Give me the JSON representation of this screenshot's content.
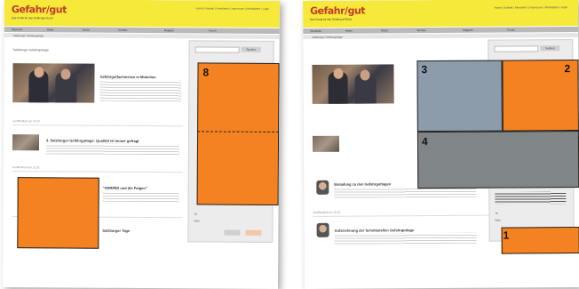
{
  "brand": {
    "logo": "Gefahr/gut",
    "tagline": "Das Portal für das Gefahrgut-Recht"
  },
  "header": {
    "top_links": "Home | Kontakt | Newsletter | Impressum | Mediadaten | Login"
  },
  "left": {
    "nav": [
      "Startseite",
      "News",
      "Recht",
      "Termine",
      "Magazin",
      "Forum"
    ],
    "subnav": "Salzburger Gefahrguttage",
    "section_title": "Salzburger Gefahrguttage",
    "articles": [
      {
        "headline": "Gefahrgutfachmesse in München",
        "date": "veröffentlicht am 10.10.",
        "more": "mehr"
      },
      {
        "headline": "3. Salzburger Gefahrguttage: Qualität ist immer gefragt",
        "date": "veröffentlicht am 12.10.",
        "more": "mehr"
      },
      {
        "headline": "\"ADR/RID und die Folgen\"",
        "date": "veröffentlicht am 14.10.",
        "more": "mehr"
      },
      {
        "headline": "Salzburger Tage",
        "date": "",
        "more": ""
      }
    ],
    "sidebar": {
      "search_button": "Suchen",
      "poll_yes": "Ja",
      "poll_no": "Nein"
    },
    "regions": [
      {
        "label": "8",
        "color": "#f58220"
      },
      {
        "label": "",
        "color": "#f58220"
      }
    ]
  },
  "right": {
    "nav": [
      "Startseite",
      "News",
      "Recht",
      "Termine",
      "Magazin",
      "Forum"
    ],
    "subnav": "Salzburger Gefahrguttage",
    "articles": [
      {
        "headline": "Einladung zu den Gefahrguttagen",
        "date": "veröffentlicht am 16.10.",
        "more": "mehr"
      },
      {
        "headline": "Aufzeichnung der Schnittstellen Gefahrguttage",
        "date": "veröffentlicht am 18.10.",
        "more": "mehr"
      },
      {
        "headline": "Anfahrt zu den Salzburger Tagen",
        "date": "",
        "more": ""
      }
    ],
    "sidebar": {
      "search_button": "Suchen",
      "poll_yes": "Ja",
      "poll_no": "Nein"
    },
    "regions": [
      {
        "label": "3",
        "color": "#8c9cab"
      },
      {
        "label": "2",
        "color": "#f58220"
      },
      {
        "label": "4",
        "color": "#808588"
      },
      {
        "label": "1",
        "color": "#f58220"
      }
    ]
  }
}
